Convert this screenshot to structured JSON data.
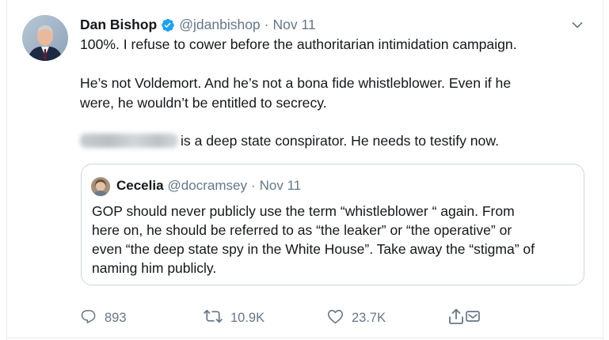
{
  "tweet": {
    "author_name": "Dan Bishop",
    "handle": "@jdanbishop",
    "separator": "·",
    "date": "Nov 11",
    "lines": {
      "l1": "100%.  I refuse to cower before the authoritarian intimidation campaign.",
      "l2": "He’s not Voldemort.  And he’s not a bona fide whistleblower.  Even if he",
      "l3": "were, he wouldn’t be entitled to secrecy.",
      "l4_after_blur": "is a deep state conspirator. He needs to testify now."
    }
  },
  "quote": {
    "author_name": "Cecelia",
    "handle": "@docramsey",
    "separator": "·",
    "date": "Nov 11",
    "lines": {
      "l1": "GOP should never publicly use the term “whistleblower “ again. From",
      "l2": "here on, he should be referred to as “the leaker” or “the operative” or",
      "l3": "even “the deep state spy in the White House”. Take away the “stigma” of",
      "l4": "naming him publicly."
    }
  },
  "actions": {
    "replies": "893",
    "retweets": "10.9K",
    "likes": "23.7K"
  },
  "icons": {
    "verified": "verified-badge-icon",
    "caret": "chevron-down-icon",
    "reply": "reply-icon",
    "retweet": "retweet-icon",
    "like": "heart-icon",
    "share": "share-icon",
    "dm": "direct-message-icon"
  },
  "colors": {
    "text": "#14171a",
    "secondary": "#657786",
    "verified": "#1da1f2",
    "border": "#ccd6dd"
  }
}
